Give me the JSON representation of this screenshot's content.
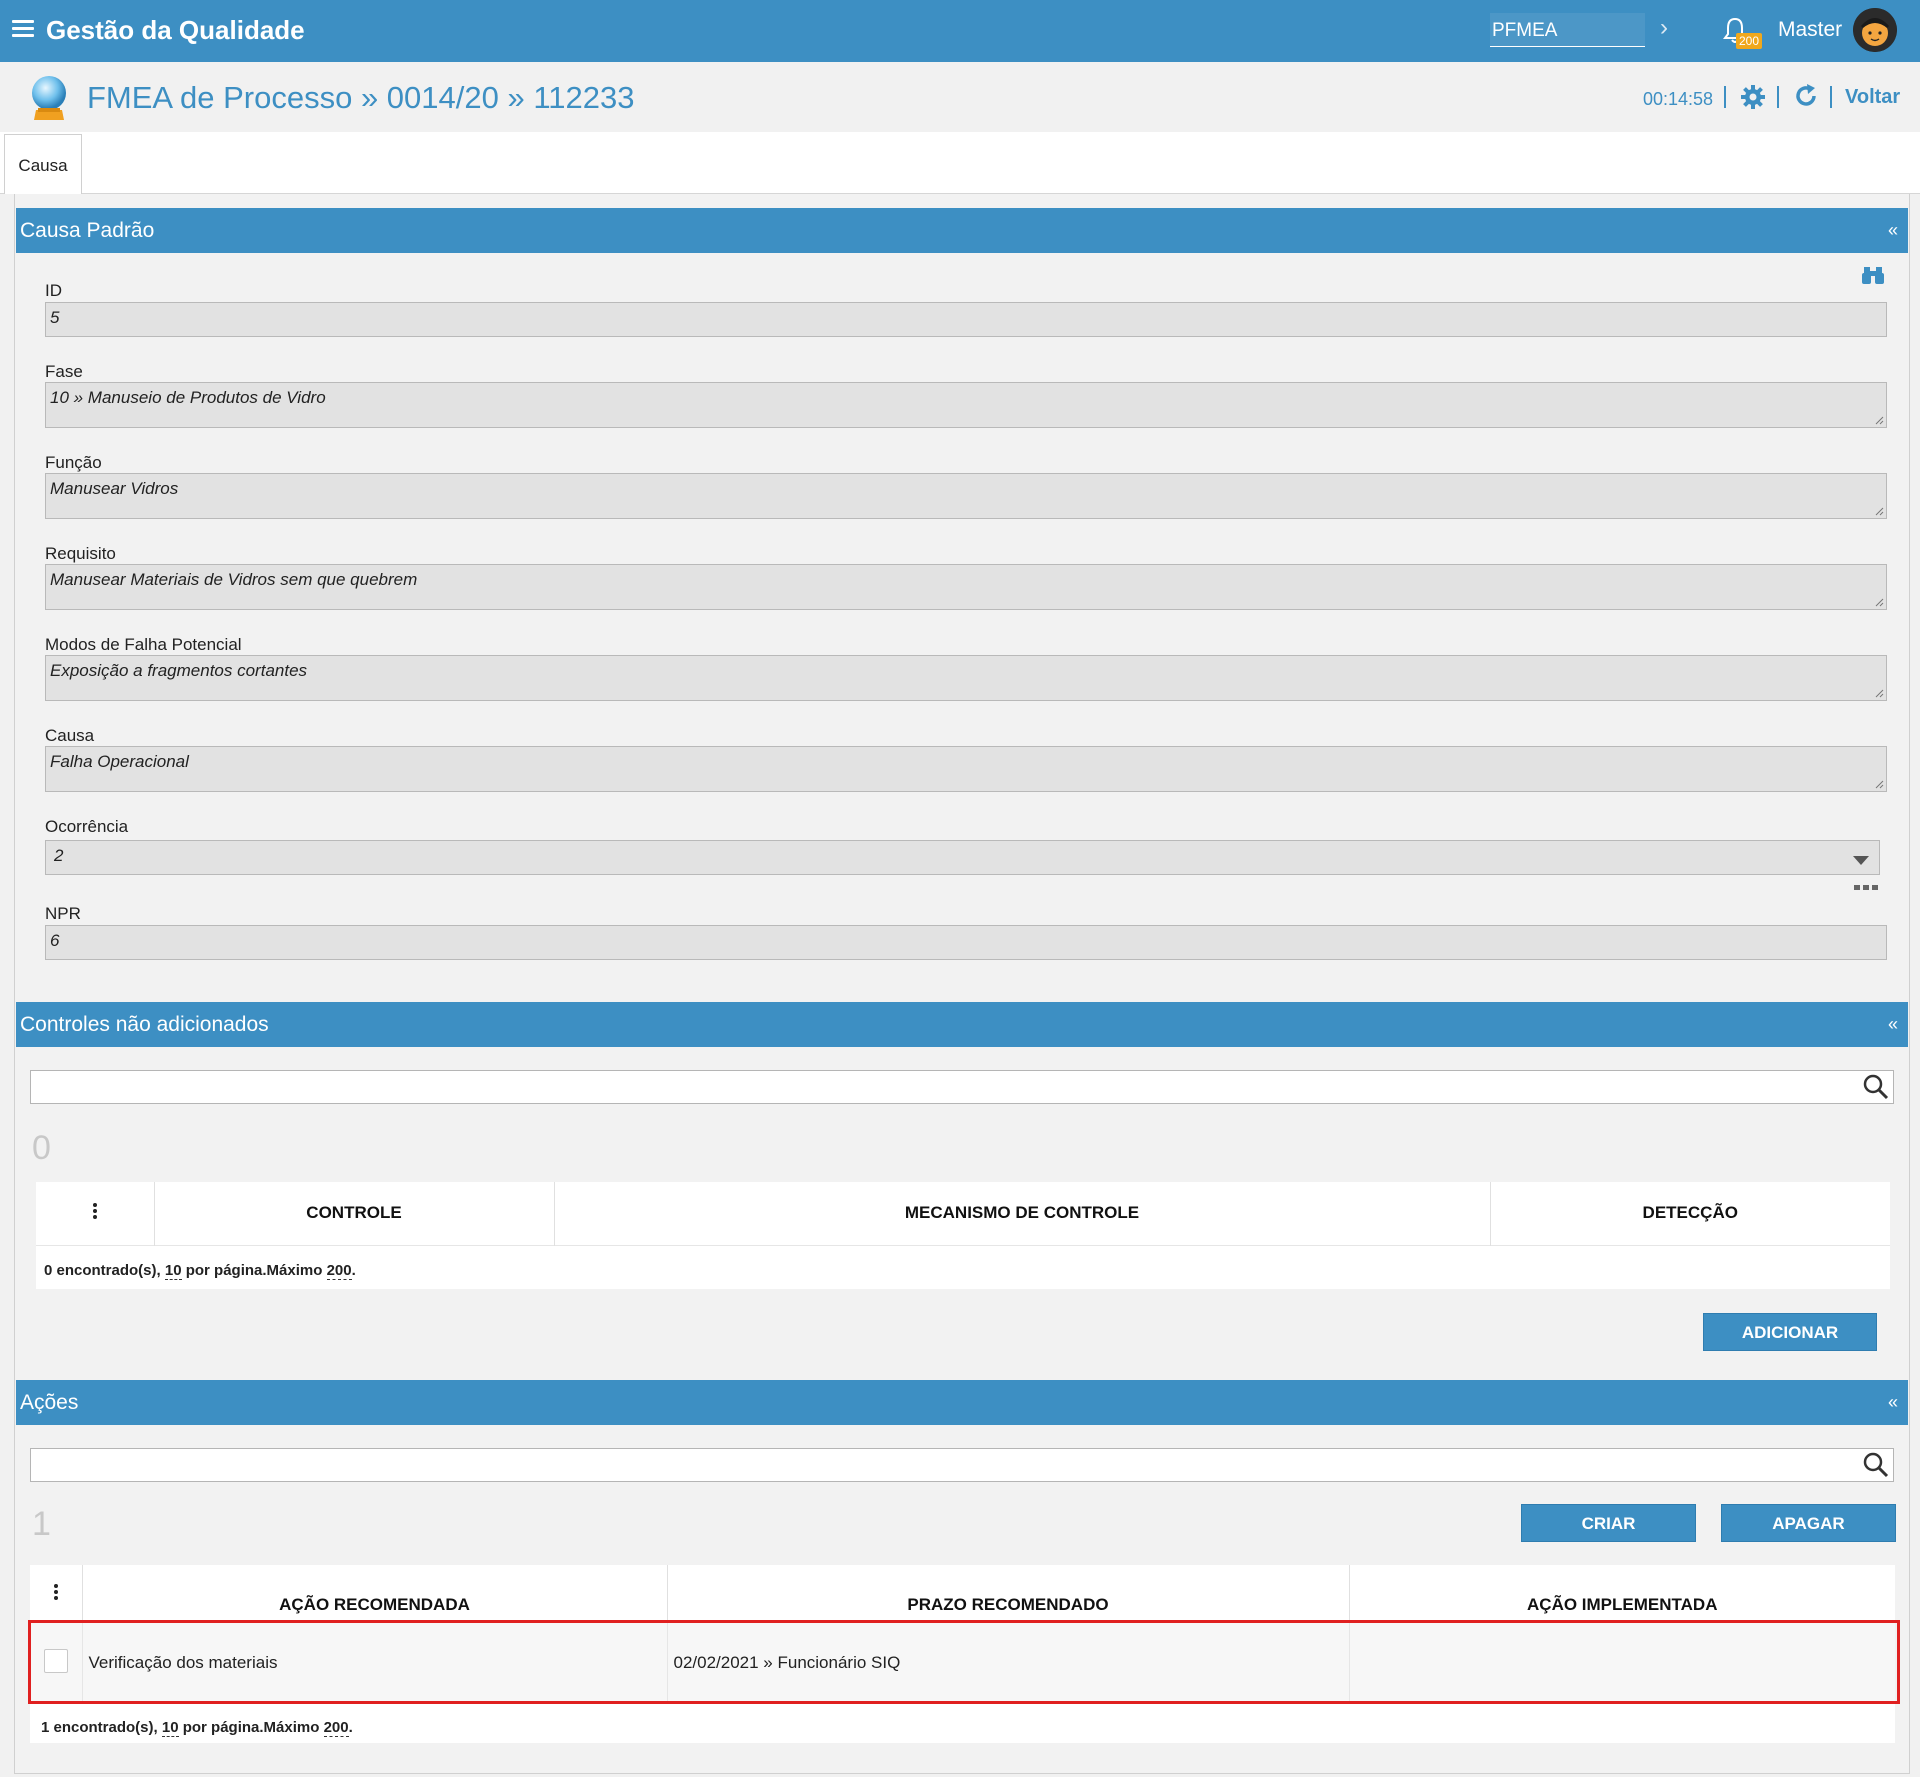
{
  "app": {
    "title": "Gestão da Qualidade",
    "module": "PFMEA",
    "notifications": "200",
    "user": "Master"
  },
  "header": {
    "title": "FMEA de Processo » 0014/20 » 112233",
    "timer": "00:14:58",
    "back_label": "Voltar"
  },
  "tabs": [
    {
      "label": "Causa"
    }
  ],
  "causa": {
    "section_title": "Causa Padrão",
    "collapse": "«",
    "fields": {
      "id": {
        "label": "ID",
        "value": "5"
      },
      "fase": {
        "label": "Fase",
        "value": "10 » Manuseio de Produtos de Vidro"
      },
      "funcao": {
        "label": "Função",
        "value": "Manusear Vidros"
      },
      "requisito": {
        "label": "Requisito",
        "value": "Manusear Materiais de Vidros sem que quebrem"
      },
      "modos": {
        "label": "Modos de Falha Potencial",
        "value": "Exposição a fragmentos cortantes"
      },
      "causa": {
        "label": "Causa",
        "value": "Falha Operacional"
      },
      "ocorrencia": {
        "label": "Ocorrência",
        "value": "2"
      },
      "npr": {
        "label": "NPR",
        "value": "6"
      }
    }
  },
  "controles": {
    "section_title": "Controles não adicionados",
    "collapse": "«",
    "search_value": "",
    "count": "0",
    "columns": [
      "CONTROLE",
      "MECANISMO DE CONTROLE",
      "DETECÇÃO"
    ],
    "rows": [],
    "footer": {
      "found": "0 encontrado(s), ",
      "per_page": "10",
      "per_page_text": " por página.Máximo ",
      "max": "200",
      "end": "."
    },
    "add_button": "ADICIONAR"
  },
  "acoes": {
    "section_title": "Ações",
    "collapse": "«",
    "search_value": "",
    "count": "1",
    "create_button": "CRIAR",
    "delete_button": "APAGAR",
    "columns": [
      "AÇÃO RECOMENDADA",
      "PRAZO RECOMENDADO",
      "AÇÃO IMPLEMENTADA"
    ],
    "rows": [
      {
        "acao": "Verificação dos materiais",
        "prazo": "02/02/2021 » Funcionário SIQ",
        "implementada": ""
      }
    ],
    "footer": {
      "found": "1 encontrado(s), ",
      "per_page": "10",
      "per_page_text": " por página.Máximo ",
      "max": "200",
      "end": "."
    }
  },
  "colors": {
    "primary": "#3d8fc3",
    "badge": "#f0a81c",
    "highlight": "#e02020"
  },
  "icons": [
    "menu-icon",
    "chevron-right-icon",
    "bell-icon",
    "avatar",
    "crystal-ball-icon",
    "gear-icon",
    "refresh-icon",
    "binoculars-icon",
    "search-icon",
    "more-dots-icon",
    "vertical-dots-icon"
  ]
}
